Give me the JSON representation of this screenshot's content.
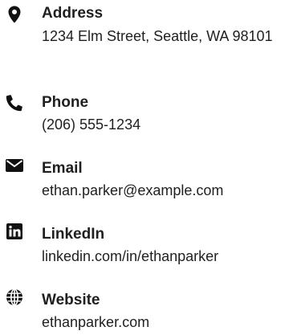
{
  "colors": {
    "text": "#1f1f1f",
    "icon": "#111111",
    "background": "#ffffff"
  },
  "contacts": [
    {
      "icon": "map-pin-icon",
      "label": "Address",
      "value": "1234 Elm Street, Seattle, WA 98101"
    },
    {
      "icon": "phone-icon",
      "label": "Phone",
      "value": "(206) 555-1234"
    },
    {
      "icon": "envelope-icon",
      "label": "Email",
      "value": "ethan.parker@example.com"
    },
    {
      "icon": "linkedin-icon",
      "label": "LinkedIn",
      "value": "linkedin.com/in/ethanparker"
    },
    {
      "icon": "globe-icon",
      "label": "Website",
      "value": "ethanparker.com"
    }
  ]
}
